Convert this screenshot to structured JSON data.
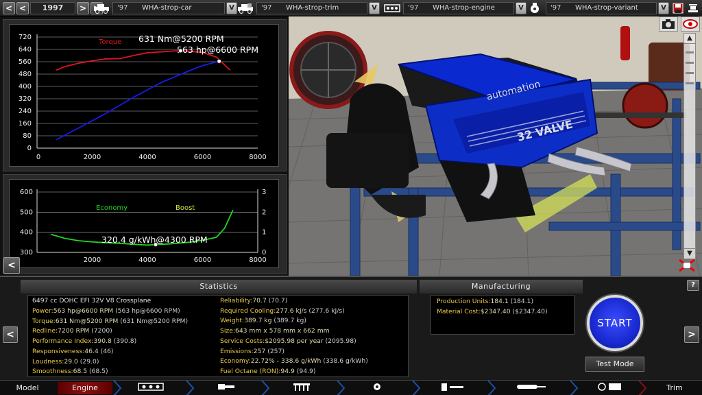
{
  "top_bar": {
    "year": "1997",
    "car": {
      "year": "'97",
      "name": "WHA-strop-car"
    },
    "trim": {
      "year": "'97",
      "name": "WHA-strop-trim"
    },
    "engine": {
      "year": "'97",
      "name": "WHA-strop-engine"
    },
    "variant": {
      "year": "'97",
      "name": "WHA-strop-variant"
    },
    "v_label": "V",
    "prev": "<",
    "next": ">"
  },
  "chart_data": [
    {
      "type": "line",
      "x_ticks": [
        "0",
        "2000",
        "4000",
        "6000",
        "8000"
      ],
      "y_ticks": [
        "0",
        "80",
        "160",
        "240",
        "320",
        "400",
        "480",
        "560",
        "640",
        "720"
      ],
      "xlim": [
        0,
        8000
      ],
      "ylim": [
        0,
        720
      ],
      "series": [
        {
          "name": "Torque",
          "color": "#e0141e",
          "x": [
            700,
            1000,
            1500,
            2000,
            2500,
            3000,
            3500,
            4000,
            4500,
            5000,
            5200,
            5500,
            6000,
            6500,
            7000
          ],
          "y": [
            505,
            528,
            550,
            566,
            578,
            580,
            600,
            618,
            624,
            630,
            631,
            628,
            620,
            590,
            505
          ]
        },
        {
          "name": "",
          "color": "#1a1aee",
          "x": [
            700,
            1500,
            2500,
            3500,
            4500,
            5500,
            6000,
            6600
          ],
          "y": [
            55,
            130,
            225,
            330,
            425,
            500,
            535,
            563
          ]
        }
      ],
      "annotations": [
        "631 Nm@5200 RPM",
        "563 hp@6600 RPM"
      ],
      "markers": [
        {
          "x": 5200,
          "y": 631
        },
        {
          "x": 6600,
          "y": 563
        }
      ]
    },
    {
      "type": "line",
      "x_ticks": [
        "2000",
        "4000",
        "6000",
        "8000"
      ],
      "y_ticks_left": [
        "300",
        "400",
        "500",
        "600"
      ],
      "y_ticks_right": [
        "0",
        "1",
        "2",
        "3"
      ],
      "xlim": [
        0,
        8000
      ],
      "ylim": [
        300,
        600
      ],
      "y2lim": [
        0,
        3
      ],
      "legend": [
        "Economy",
        "Boost"
      ],
      "series": [
        {
          "name": "Economy",
          "color": "#22d622",
          "x": [
            500,
            1000,
            1500,
            2000,
            2500,
            3000,
            3500,
            4000,
            4300,
            4800,
            5500,
            6000,
            6500,
            6800,
            7100
          ],
          "y": [
            390,
            370,
            358,
            352,
            348,
            345,
            340,
            336,
            338.6,
            342,
            350,
            360,
            375,
            420,
            510
          ]
        },
        {
          "name": "Boost",
          "color": "#d6e04a",
          "x": [],
          "y": []
        }
      ],
      "annotations": [
        "320.4 g/kWh@4300 RPM"
      ],
      "markers": [
        {
          "x": 4300,
          "y": 338.6
        }
      ]
    }
  ],
  "statistics": {
    "title": "Statistics",
    "engine_desc": "6497 cc DOHC EFI 32V V8 Crossplane",
    "left": [
      {
        "key": "Power:",
        "value": "563 hp@6600 RPM",
        "prev": "(563 hp@6600 RPM)"
      },
      {
        "key": "Torque:",
        "value": "631 Nm@5200 RPM",
        "prev": "(631 Nm@5200 RPM)"
      },
      {
        "key": "Redline:",
        "value": "7200 RPM",
        "prev": "(7200)"
      },
      {
        "key": "Performance Index:",
        "value": "390.8",
        "prev": "(390.8)"
      },
      {
        "key": "Responsiveness:",
        "value": "46.4",
        "prev": "(46)"
      },
      {
        "key": "Loudness:",
        "value": "29.0",
        "prev": "(29.0)"
      },
      {
        "key": "Smoothness:",
        "value": "68.5",
        "prev": "(68.5)"
      }
    ],
    "right": [
      {
        "key": "Reliability:",
        "value": "70.7",
        "prev": "(70.7)"
      },
      {
        "key": "Required Cooling:",
        "value": "277.6 kJ/s",
        "prev": "(277.6 kJ/s)"
      },
      {
        "key": "Weight:",
        "value": "389.7 kg",
        "prev": "(389.7 kg)"
      },
      {
        "key": "Size:",
        "value": "643 mm x 578 mm x 662 mm",
        "prev": ""
      },
      {
        "key": "Service Costs:",
        "value": "$2095.98 per year",
        "prev": "(2095.98)"
      },
      {
        "key": "Emissions:",
        "value": "257",
        "prev": "(257)"
      },
      {
        "key": "Economy:",
        "value": "22.72% - 338.6 g/kWh",
        "prev": "(338.6 g/kWh)"
      },
      {
        "key": "Fuel Octane (RON):",
        "value": "94.9",
        "prev": "(94.9)"
      }
    ]
  },
  "manufacturing": {
    "title": "Manufacturing",
    "items": [
      {
        "key": "Production Units:",
        "value": "184.1",
        "prev": "(184.1)"
      },
      {
        "key": "Material Cost:",
        "value": "$2347.40",
        "prev": "($2347.40)"
      }
    ]
  },
  "actions": {
    "start": "START",
    "test_mode": "Test Mode",
    "help": "?",
    "prev": "<",
    "next": ">"
  },
  "nav": {
    "model": "Model",
    "engine": "Engine",
    "trim": "Trim"
  },
  "engine_decal": {
    "top": "automation",
    "side": "32 VALVE"
  }
}
